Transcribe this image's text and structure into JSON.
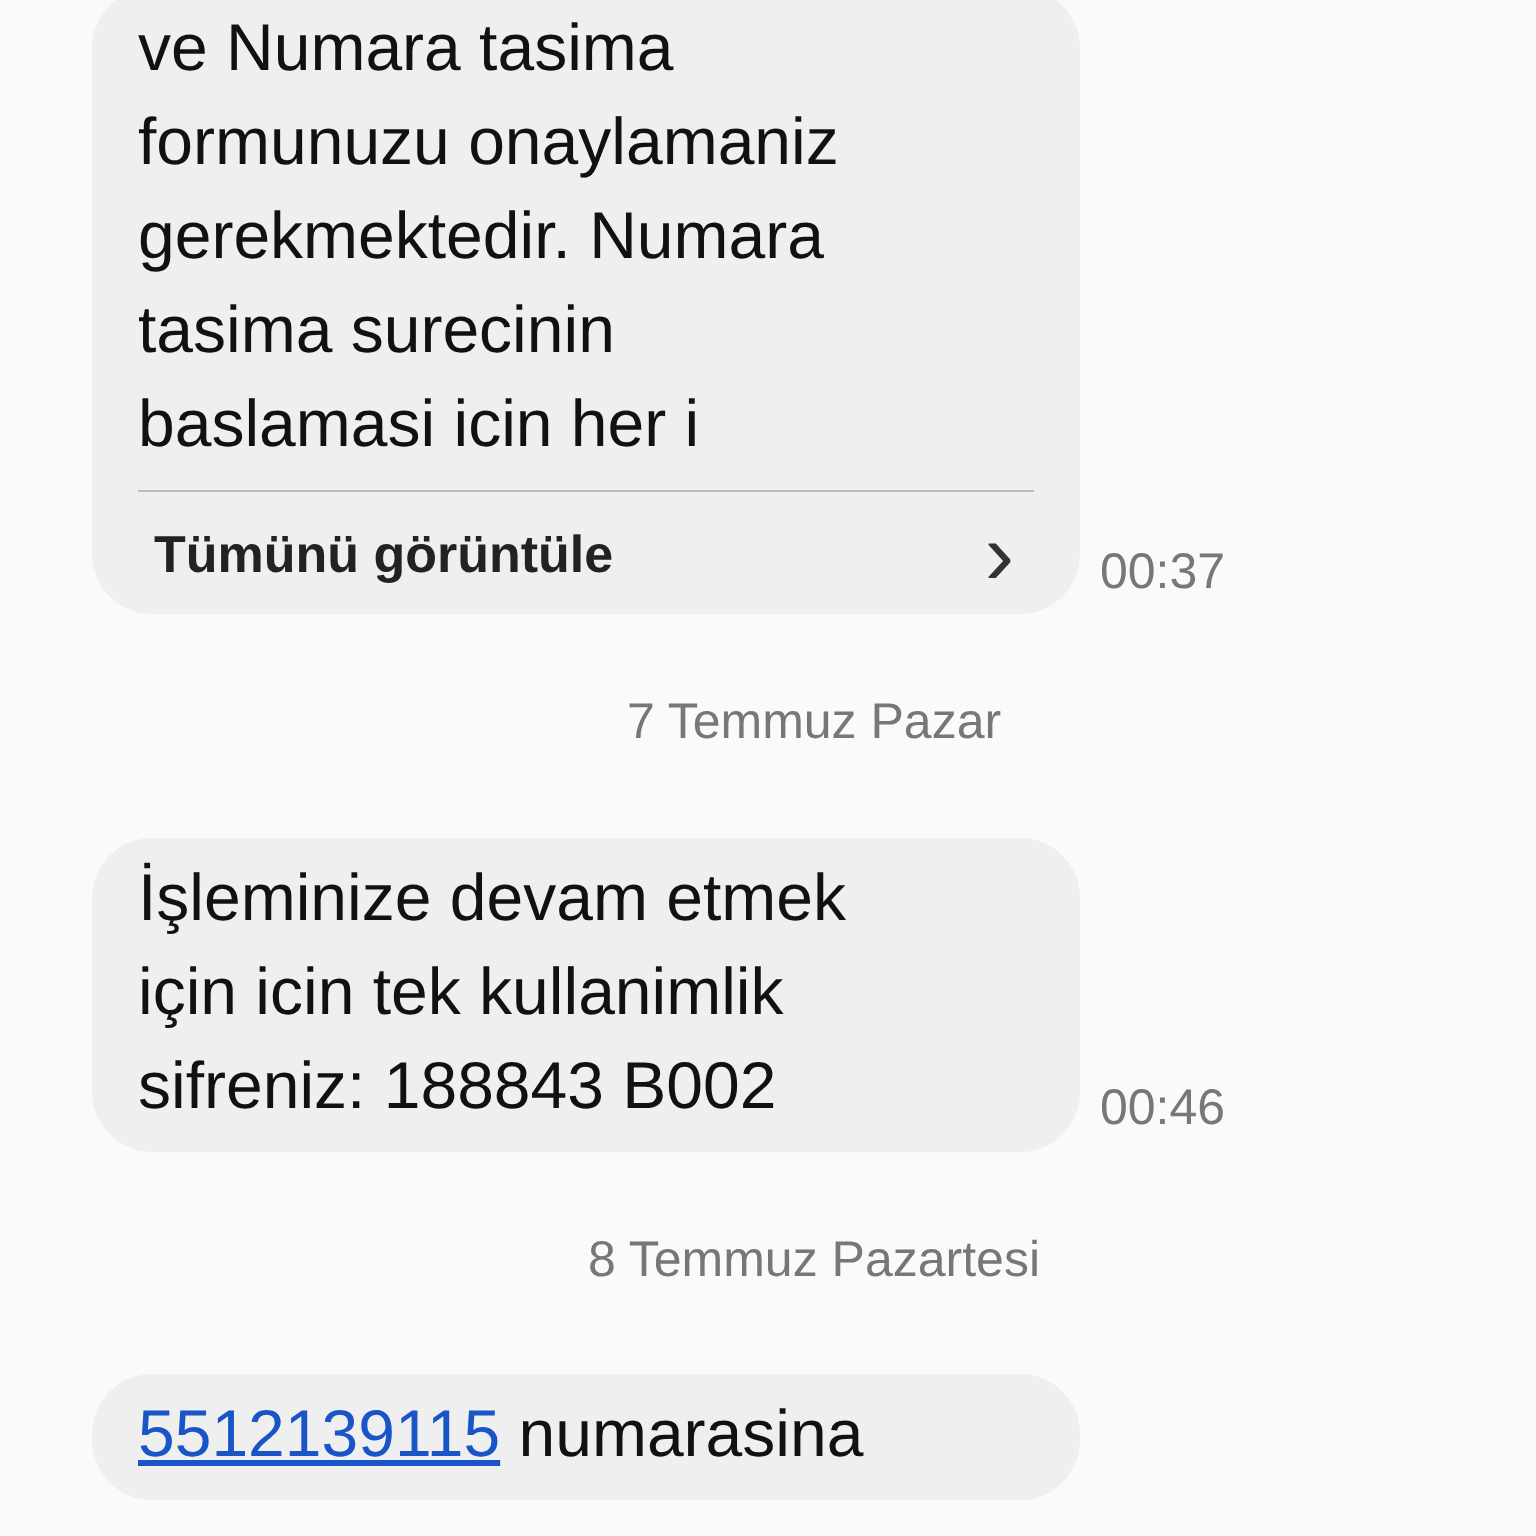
{
  "messages": [
    {
      "kind": "message",
      "lines": [
        "ve Numara tasima",
        "formunuzu onaylamaniz",
        "gerekmektedir. Numara",
        "tasima surecinin",
        "baslamasi icin her i"
      ],
      "more": {
        "label": "Tümünü görüntüle",
        "chevron": "›"
      },
      "time": "00:37"
    },
    {
      "kind": "date",
      "label": "7 Temmuz Pazar"
    },
    {
      "kind": "message",
      "lines": [
        "İşleminize devam etmek",
        "için icin tek kullanimlik",
        "sifreniz: 188843 B002"
      ],
      "time": "00:46"
    },
    {
      "kind": "date",
      "label": "8 Temmuz Pazartesi"
    },
    {
      "kind": "message",
      "link": "5512139115",
      "lines": [
        " numarasina"
      ]
    }
  ]
}
